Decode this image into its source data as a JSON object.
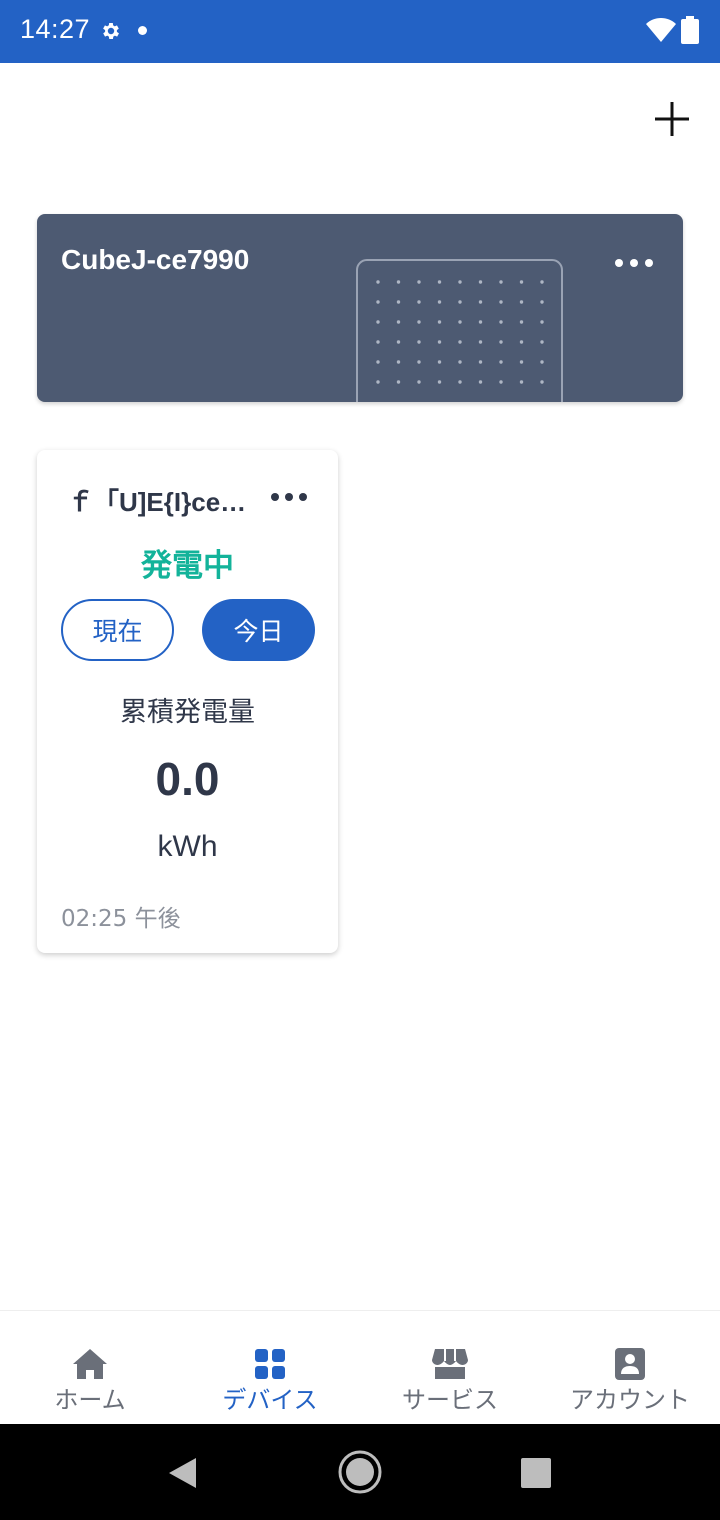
{
  "status_bar": {
    "time": "14:27",
    "icons": [
      "gear-icon",
      "notification-dot-icon",
      "wifi-icon",
      "battery-icon"
    ],
    "color": "#2362c5"
  },
  "header": {
    "add_icon": "plus-icon"
  },
  "hub": {
    "name": "CubeJ-ce7990",
    "background_color": "#4d5a72",
    "more_icon": "more-dots-icon"
  },
  "device": {
    "name": "ｆ「U]E{I}ce…",
    "status": "発電中",
    "status_color": "#13b39a",
    "toggle": {
      "now_label": "現在",
      "today_label": "今日",
      "selected": "今日"
    },
    "metric_label": "累積発電量",
    "value": "0.0",
    "unit": "kWh",
    "updated": "02:25 午後"
  },
  "bottom_nav": {
    "items": [
      {
        "label": "ホーム",
        "icon": "home-icon",
        "active": false
      },
      {
        "label": "デバイス",
        "icon": "grid-icon",
        "active": true
      },
      {
        "label": "サービス",
        "icon": "store-icon",
        "active": false
      },
      {
        "label": "アカウント",
        "icon": "account-icon",
        "active": false
      }
    ],
    "active_color": "#2362c5"
  },
  "system_nav": {
    "icons": [
      "back-icon",
      "home-circle-icon",
      "recents-icon"
    ]
  }
}
